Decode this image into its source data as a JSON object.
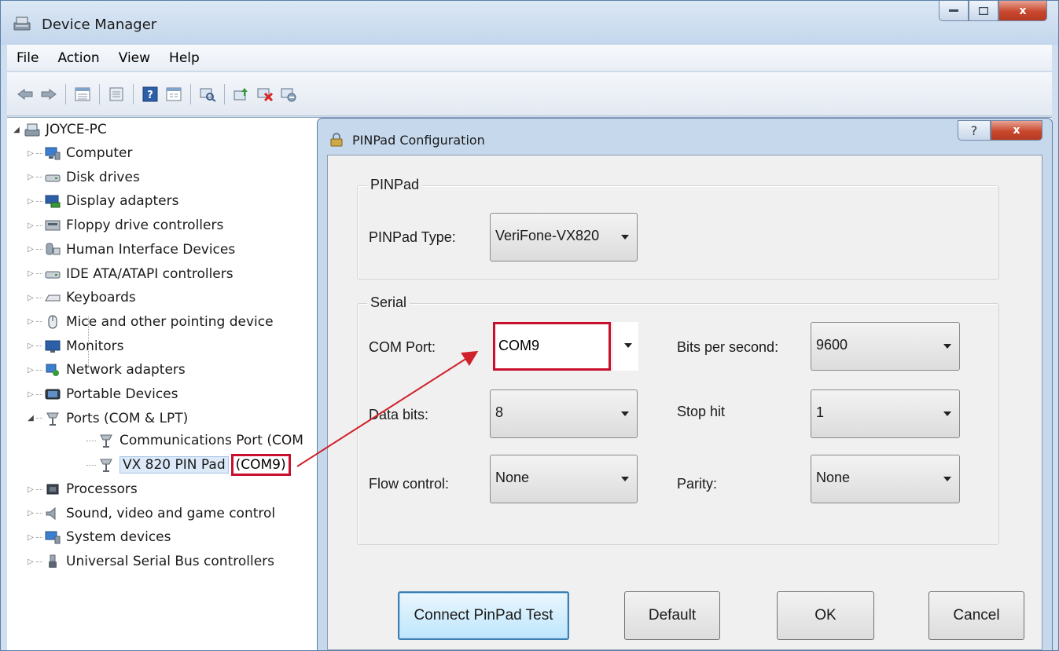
{
  "window": {
    "title": "Device Manager",
    "caption": {
      "minimize": "",
      "maximize": "",
      "close": "x"
    }
  },
  "menu": [
    "File",
    "Action",
    "View",
    "Help"
  ],
  "toolbar_icons": [
    "back-arrow-icon",
    "forward-arrow-icon",
    "properties-grid-icon",
    "console-icon",
    "help-icon",
    "show-hidden-icon",
    "scan-hardware-icon",
    "update-driver-icon",
    "uninstall-device-icon",
    "disable-device-icon"
  ],
  "tree": {
    "root": "JOYCE-PC",
    "items": [
      {
        "label": "Computer",
        "icon": "computer-icon"
      },
      {
        "label": "Disk drives",
        "icon": "disk-drive-icon"
      },
      {
        "label": "Display adapters",
        "icon": "display-adapter-icon"
      },
      {
        "label": "Floppy drive controllers",
        "icon": "floppy-controller-icon"
      },
      {
        "label": "Human Interface Devices",
        "icon": "hid-icon"
      },
      {
        "label": "IDE ATA/ATAPI controllers",
        "icon": "ide-controller-icon"
      },
      {
        "label": "Keyboards",
        "icon": "keyboard-icon"
      },
      {
        "label": "Mice and other pointing device",
        "icon": "mouse-icon"
      },
      {
        "label": "Monitors",
        "icon": "monitor-icon"
      },
      {
        "label": "Network adapters",
        "icon": "network-adapter-icon"
      },
      {
        "label": "Portable Devices",
        "icon": "portable-device-icon"
      },
      {
        "label": "Ports (COM & LPT)",
        "icon": "port-icon"
      }
    ],
    "ports_children": [
      {
        "label": "Communications Port (COM",
        "suffix": ""
      },
      {
        "label": "VX 820 PIN Pad",
        "suffix": "(COM9)"
      }
    ],
    "items_after": [
      {
        "label": "Processors",
        "icon": "processor-icon"
      },
      {
        "label": "Sound, video and game control",
        "icon": "sound-icon"
      },
      {
        "label": "System devices",
        "icon": "system-device-icon"
      },
      {
        "label": "Universal Serial Bus controllers",
        "icon": "usb-icon"
      }
    ]
  },
  "dialog": {
    "title": "PINPad Configuration",
    "help": "?",
    "close": "x",
    "pinpad_group": "PINPad",
    "pinpad_type_label": "PINPad Type:",
    "pinpad_type_value": "VeriFone-VX820",
    "serial_group": "Serial",
    "com_port_label": "COM Port:",
    "com_port_value": "COM9",
    "bits_label": "Bits per second:",
    "bits_value": "9600",
    "data_bits_label": "Data bits:",
    "data_bits_value": "8",
    "stop_label": "Stop hit",
    "stop_value": "1",
    "flow_label": "Flow control:",
    "flow_value": "None",
    "parity_label": "Parity:",
    "parity_value": "None",
    "buttons": {
      "connect": "Connect PinPad Test",
      "default": "Default",
      "ok": "OK",
      "cancel": "Cancel"
    }
  },
  "annotation": {
    "highlight_color": "#c8102e",
    "arrow_color": "#d0202a"
  }
}
